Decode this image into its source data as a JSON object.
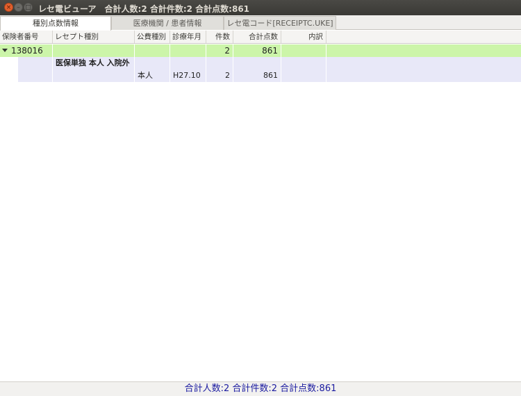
{
  "window": {
    "title": "レセ電ビューア　合計人数:2 合計件数:2 合計点数:861",
    "close_glyph": "×",
    "min_glyph": "–",
    "max_glyph": "□"
  },
  "tabs": [
    {
      "label": "種別点数情報",
      "active": true
    },
    {
      "label": "医療機関 / 患者情報",
      "active": false
    },
    {
      "label": "レセ電コード[RECEIPTC.UKE]",
      "active": false
    }
  ],
  "table": {
    "headers": [
      "保険者番号",
      "レセプト種別",
      "公費種別",
      "診療年月",
      "件数",
      "合計点数",
      "内訳"
    ],
    "rows": [
      {
        "insurer": "138016",
        "receipt_type": "",
        "public_type": "",
        "month": "",
        "count": "2",
        "points": "861",
        "detail": ""
      },
      {
        "insurer": "",
        "receipt_type": "医保単独 本人 入院外",
        "public_type": "",
        "month": "",
        "count": "",
        "points": "",
        "detail": ""
      },
      {
        "insurer": "",
        "receipt_type": "",
        "public_type": "本人",
        "month": "H27.10",
        "count": "2",
        "points": "861",
        "detail": ""
      }
    ]
  },
  "status": {
    "text": "合計人数:2 合計件数:2 合計点数:861"
  },
  "colors": {
    "group_row": "#ccf5a9",
    "sub_row": "#e8e8f8",
    "status_text": "#1a1aa0"
  }
}
